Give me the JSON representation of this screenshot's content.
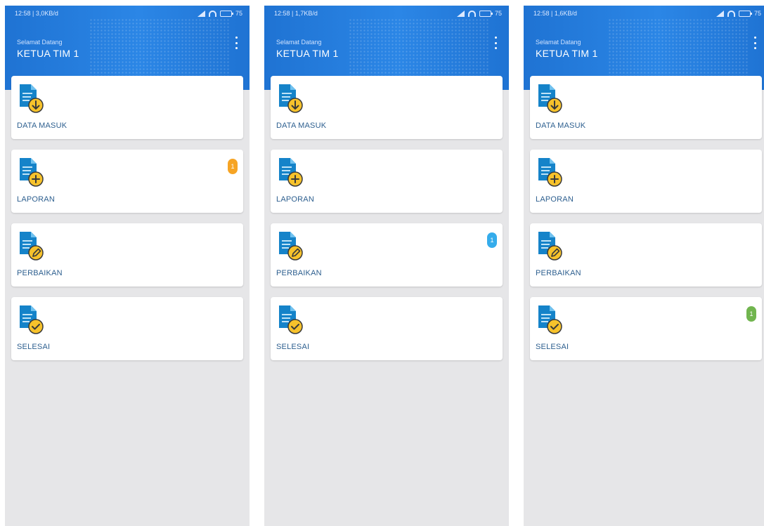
{
  "colors": {
    "header_blue": "#2b86e6",
    "label_blue": "#2d5f8f",
    "badge_orange": "#f6a019",
    "badge_blue": "#2ba8ea",
    "badge_green": "#6ab246",
    "doc_blue": "#1583c9",
    "icon_yellow": "#f7c22b"
  },
  "screens": [
    {
      "status": {
        "time": "12:58 | 3,0KB/d",
        "battery": "75"
      },
      "header": {
        "welcome": "Selamat Datang",
        "role": "KETUA TIM 1"
      },
      "menu": [
        {
          "label": "DATA MASUK",
          "icon": "document-download-icon",
          "badge": ""
        },
        {
          "label": "LAPORAN",
          "icon": "document-add-icon",
          "badge": "1"
        },
        {
          "label": "PERBAIKAN",
          "icon": "document-edit-icon",
          "badge": ""
        },
        {
          "label": "SELESAI",
          "icon": "document-check-icon",
          "badge": ""
        }
      ]
    },
    {
      "status": {
        "time": "12:58 | 1,7KB/d",
        "battery": "75"
      },
      "header": {
        "welcome": "Selamat Datang",
        "role": "KETUA TIM 1"
      },
      "menu": [
        {
          "label": "DATA MASUK",
          "icon": "document-download-icon",
          "badge": ""
        },
        {
          "label": "LAPORAN",
          "icon": "document-add-icon",
          "badge": ""
        },
        {
          "label": "PERBAIKAN",
          "icon": "document-edit-icon",
          "badge": "1"
        },
        {
          "label": "SELESAI",
          "icon": "document-check-icon",
          "badge": ""
        }
      ]
    },
    {
      "status": {
        "time": "12:58 | 1,6KB/d",
        "battery": "75"
      },
      "header": {
        "welcome": "Selamat Datang",
        "role": "KETUA TIM 1"
      },
      "menu": [
        {
          "label": "DATA MASUK",
          "icon": "document-download-icon",
          "badge": ""
        },
        {
          "label": "LAPORAN",
          "icon": "document-add-icon",
          "badge": ""
        },
        {
          "label": "PERBAIKAN",
          "icon": "document-edit-icon",
          "badge": ""
        },
        {
          "label": "SELESAI",
          "icon": "document-check-icon",
          "badge": "1"
        }
      ]
    }
  ]
}
